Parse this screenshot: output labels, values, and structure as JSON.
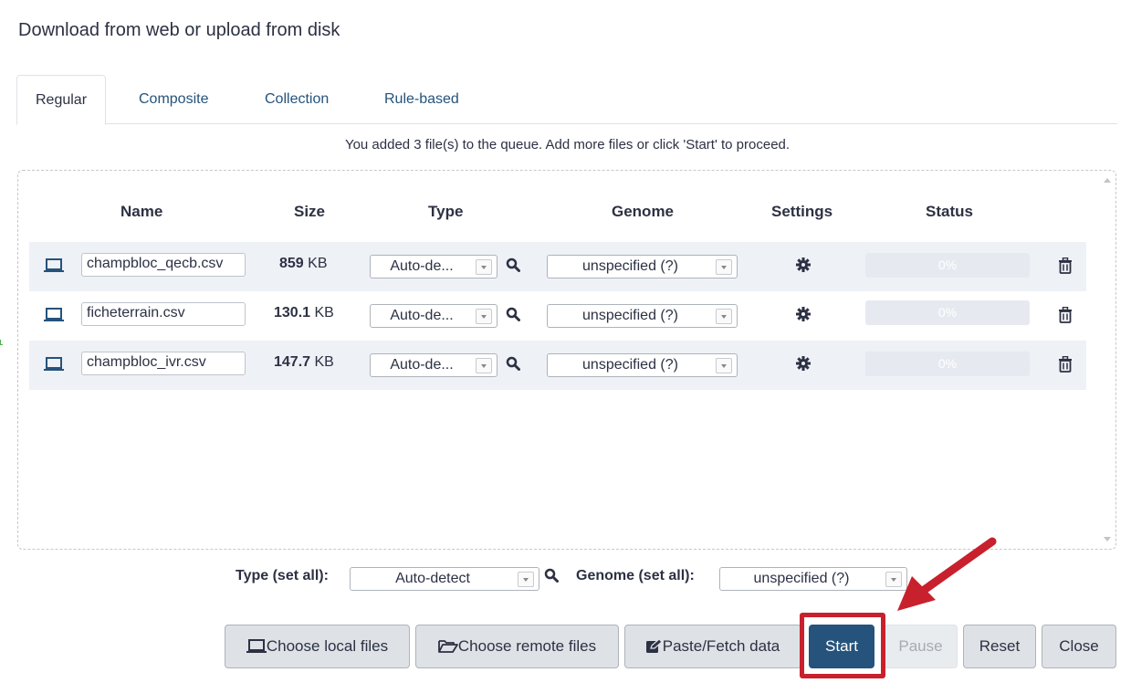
{
  "dialog": {
    "title": "Download from web or upload from disk"
  },
  "tabs": [
    {
      "label": "Regular",
      "active": true
    },
    {
      "label": "Composite",
      "active": false
    },
    {
      "label": "Collection",
      "active": false
    },
    {
      "label": "Rule-based",
      "active": false
    }
  ],
  "queue_message": "You added 3 file(s) to the queue. Add more files or click 'Start' to proceed.",
  "table": {
    "headers": {
      "name": "Name",
      "size": "Size",
      "type": "Type",
      "genome": "Genome",
      "settings": "Settings",
      "status": "Status"
    },
    "rows": [
      {
        "name": "champbloc_qecb.csv",
        "size_value": "859",
        "size_unit": "KB",
        "type": "Auto-de...",
        "genome": "unspecified (?)",
        "status": "0%"
      },
      {
        "name": "ficheterrain.csv",
        "size_value": "130.1",
        "size_unit": "KB",
        "type": "Auto-de...",
        "genome": "unspecified (?)",
        "status": "0%"
      },
      {
        "name": "champbloc_ivr.csv",
        "size_value": "147.7",
        "size_unit": "KB",
        "type": "Auto-de...",
        "genome": "unspecified (?)",
        "status": "0%"
      }
    ]
  },
  "set_all": {
    "type_label": "Type (set all):",
    "type_value": "Auto-detect",
    "genome_label": "Genome (set all):",
    "genome_value": "unspecified (?)"
  },
  "buttons": {
    "choose_local": "Choose local files",
    "choose_remote": "Choose remote files",
    "paste_fetch": "Paste/Fetch data",
    "start": "Start",
    "pause": "Pause",
    "reset": "Reset",
    "close": "Close"
  },
  "colors": {
    "primary": "#25537b",
    "highlight": "#c8202c",
    "link": "#25537b"
  },
  "icons": [
    "laptop-icon",
    "search-icon",
    "gear-icon",
    "trash-icon",
    "folder-open-icon",
    "edit-icon",
    "arrow-icon"
  ]
}
